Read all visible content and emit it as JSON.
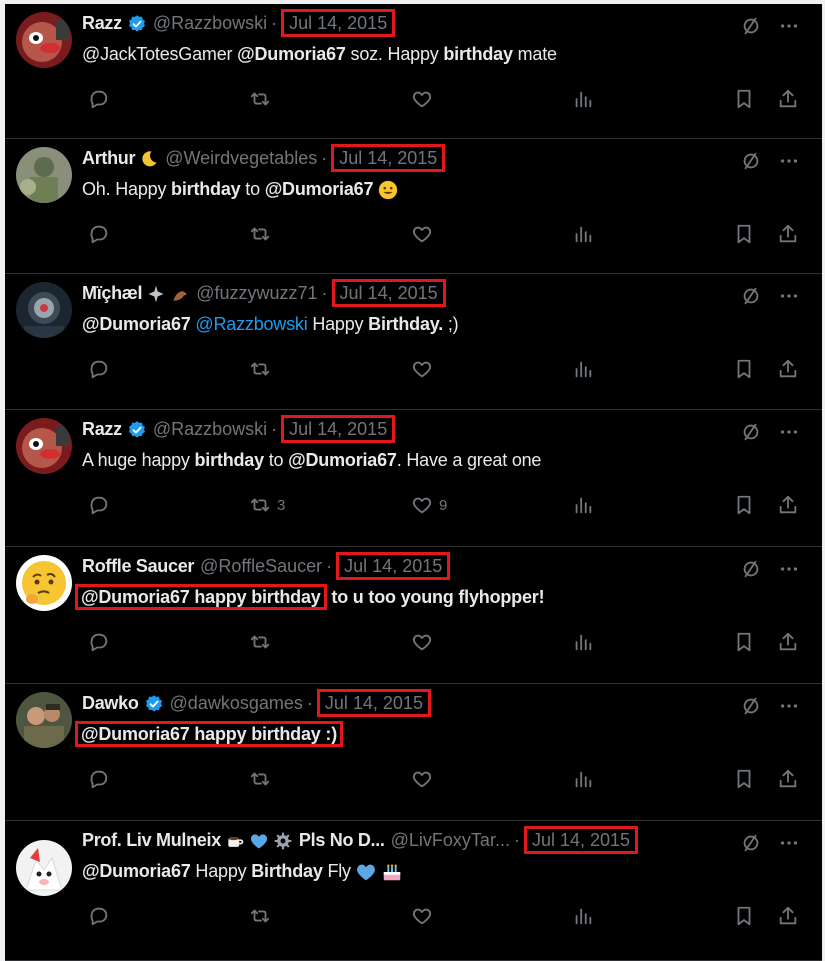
{
  "tweets": [
    {
      "name": "Razz",
      "handle": "@Razzbowski",
      "date": "Jul 14, 2015",
      "verified": true,
      "body_parts": [
        [
          "@JackTotesGamer ",
          "n"
        ],
        [
          "@Dumoria67",
          "b"
        ],
        [
          " soz. Happy ",
          "n"
        ],
        [
          "birthday",
          "b"
        ],
        [
          " mate",
          "n"
        ]
      ],
      "retweets": "",
      "likes": ""
    },
    {
      "name": "Arthur",
      "handle": "@Weirdvegetables",
      "date": "Jul 14, 2015",
      "verified": false,
      "body_parts": [
        [
          "Oh. Happy ",
          "n"
        ],
        [
          "birthday",
          "b"
        ],
        [
          " to ",
          "n"
        ],
        [
          "@Dumoria67",
          "b"
        ]
      ],
      "retweets": "",
      "likes": ""
    },
    {
      "name": "Mïçhæl",
      "handle": "@fuzzywuzz71",
      "date": "Jul 14, 2015",
      "verified": false,
      "body_parts": [
        [
          "@Dumoria67",
          "b"
        ],
        [
          " ",
          "n"
        ],
        [
          "@Razzbowski",
          "l"
        ],
        [
          " Happy ",
          "n"
        ],
        [
          "Birthday.",
          "b"
        ],
        [
          " ;)",
          "n"
        ]
      ],
      "retweets": "",
      "likes": ""
    },
    {
      "name": "Razz",
      "handle": "@Razzbowski",
      "date": "Jul 14, 2015",
      "verified": true,
      "body_parts": [
        [
          "A huge happy ",
          "n"
        ],
        [
          "birthday",
          "b"
        ],
        [
          " to ",
          "n"
        ],
        [
          "@Dumoria67",
          "b"
        ],
        [
          ". Have a great one",
          "n"
        ]
      ],
      "retweets": "3",
      "likes": "9"
    },
    {
      "name": "Roffle Saucer",
      "handle": "@RoffleSaucer",
      "date": "Jul 14, 2015",
      "verified": false,
      "highlight": "@Dumoria67 happy birthday",
      "body_rest": " to u too young flyhopper!",
      "retweets": "",
      "likes": ""
    },
    {
      "name": "Dawko",
      "handle": "@dawkosgames",
      "date": "Jul 14, 2015",
      "verified": true,
      "highlight": "@Dumoria67 happy birthday :)",
      "body_rest": "",
      "retweets": "",
      "likes": ""
    },
    {
      "name": "Prof. Liv Mulneix",
      "name_suffix": "Pls No D...",
      "handle": "@LivFoxyTar...",
      "date": "Jul 14, 2015",
      "verified": false,
      "body_parts": [
        [
          "@Dumoria67",
          "b"
        ],
        [
          " Happy ",
          "n"
        ],
        [
          "Birthday",
          "b"
        ],
        [
          " Fly",
          "n"
        ]
      ],
      "retweets": "",
      "likes": ""
    }
  ],
  "icons": {
    "reply": "reply-icon",
    "retweet": "retweet-icon",
    "like": "heart-icon",
    "views": "views-icon",
    "bookmark": "bookmark-icon",
    "share": "share-icon",
    "grok": "grok-icon",
    "more": "more-icon"
  },
  "colors": {
    "background": "#000000",
    "text": "#e7e9ea",
    "muted": "#71767b",
    "link": "#1d9bf0",
    "highlight_box": "#e0181b",
    "verified": "#1d9bf0"
  }
}
